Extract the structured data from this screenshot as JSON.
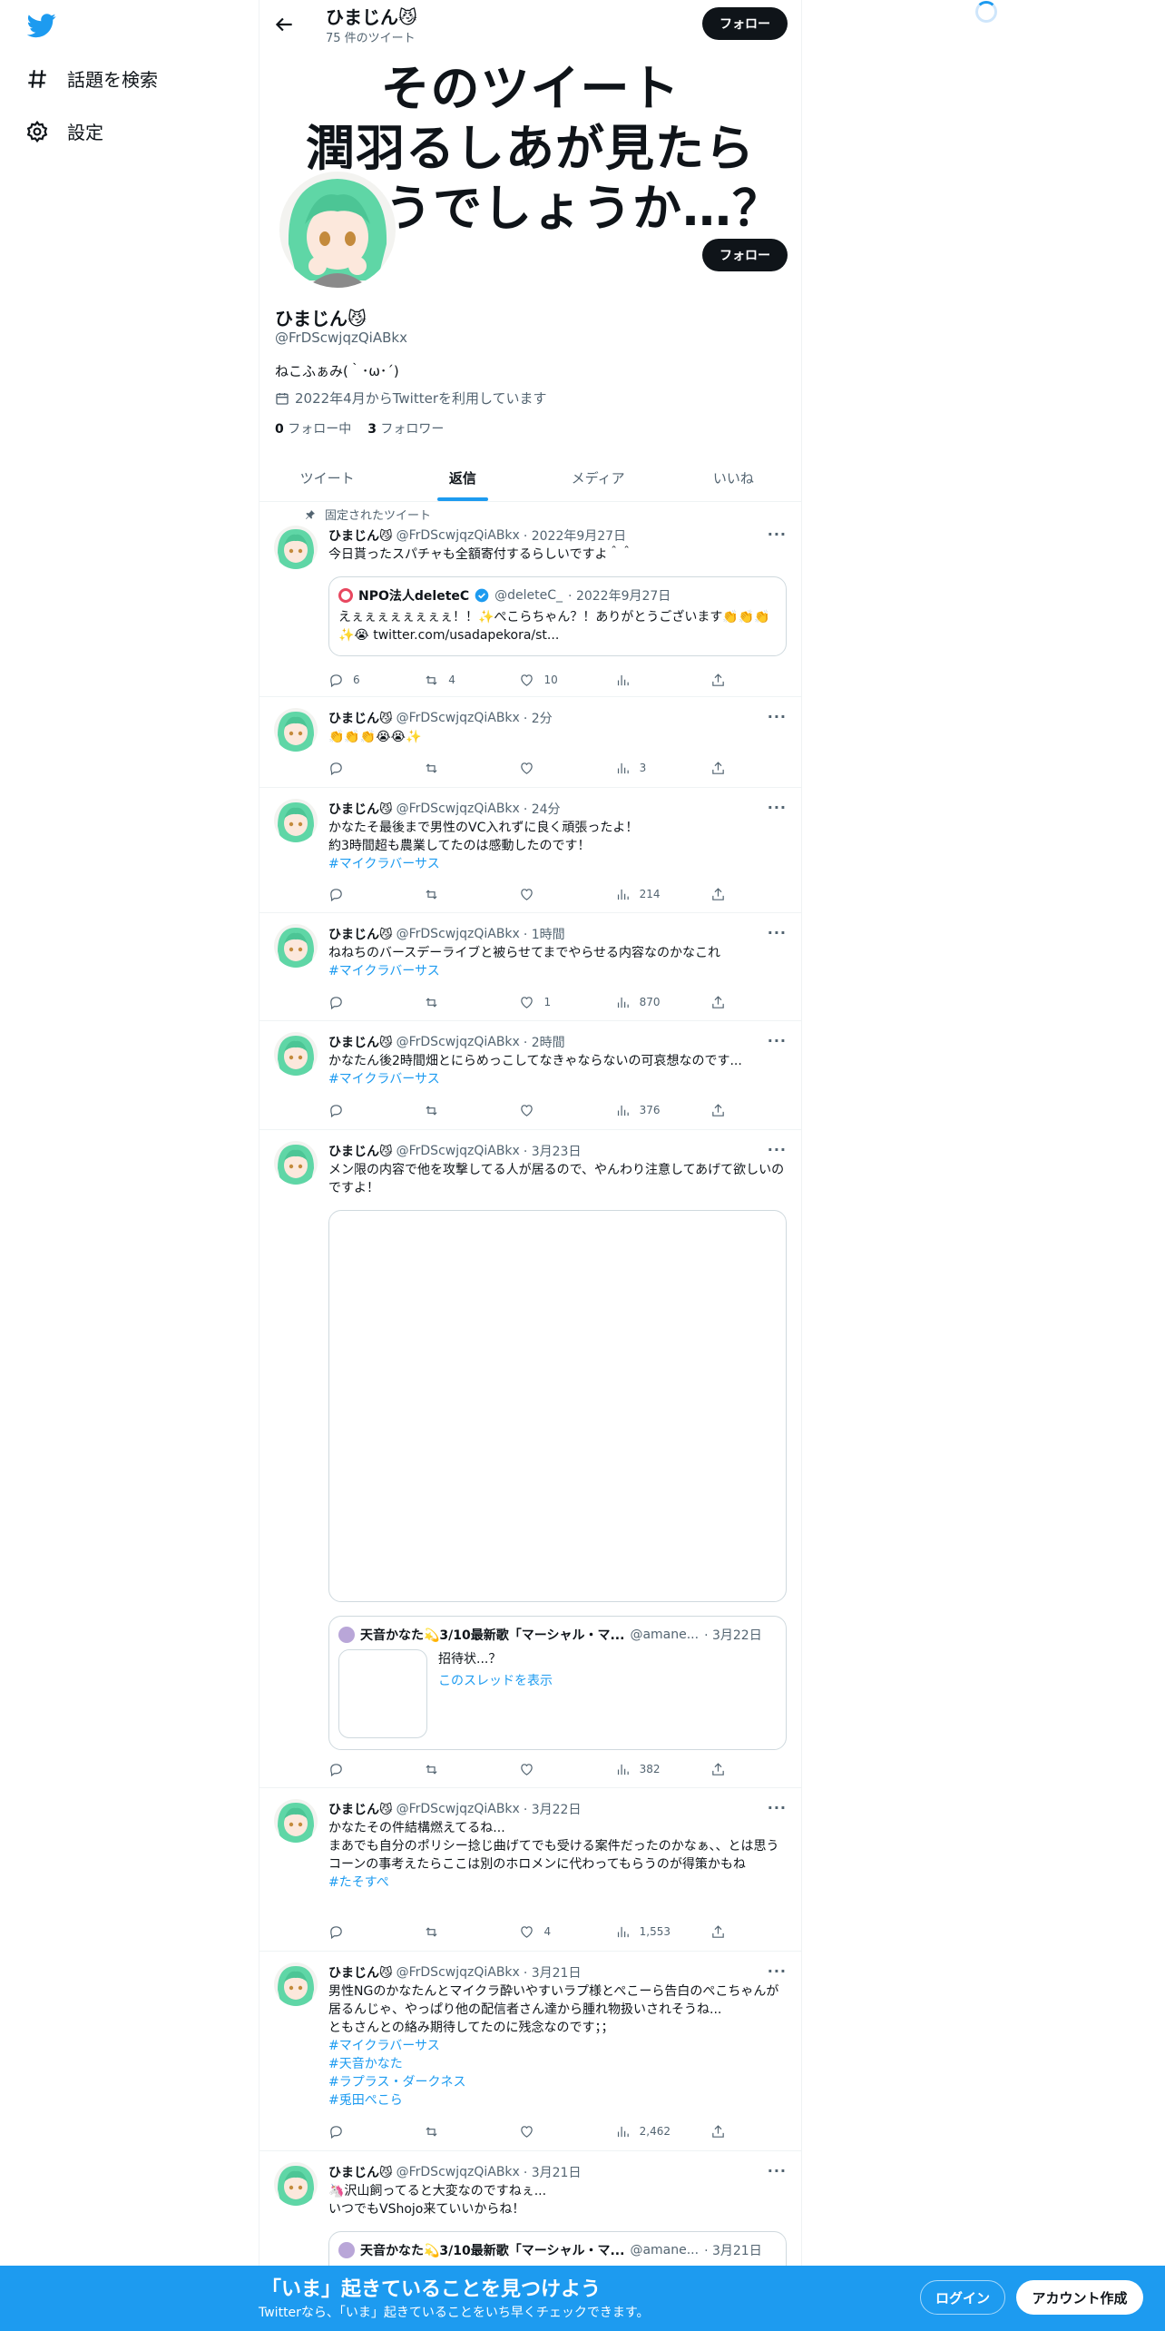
{
  "nav": {
    "explore": "話題を検索",
    "settings": "設定"
  },
  "header": {
    "name": "ひまじん😼",
    "count": "75 件のツイート",
    "follow": "フォロー"
  },
  "banner": {
    "line1": "そのツイート",
    "line2": "潤羽るしあが見たら",
    "line3": "思うでしょうか…？"
  },
  "profile": {
    "name": "ひまじん😼",
    "handle": "@FrDScwjqzQiABkx",
    "bio": "ねこふぁみ(｀･ω･´)",
    "joined": "2022年4月からTwitterを利用しています",
    "following_count": "0",
    "following_label": "フォロー中",
    "followers_count": "3",
    "followers_label": "フォロワー",
    "follow": "フォロー"
  },
  "tabs": [
    "ツイート",
    "返信",
    "メディア",
    "いいね"
  ],
  "pinned_label": "固定されたツイート",
  "tweets": [
    {
      "name": "ひまじん😼",
      "handle": "@FrDScwjqzQiABkx",
      "time": "· 2022年9月27日",
      "text": "今日貰ったスパチャも全額寄付するらしいですよ＾＾",
      "quote": {
        "name": "NPO法人deleteC",
        "handle": "@deleteC_",
        "time": "· 2022年9月27日",
        "text": "えぇぇぇぇぇぇぇぇ！！✨ぺこらちゃん？！ありがとうございます👏👏👏✨😭 twitter.com/usadapekora/st..."
      },
      "reply": "6",
      "retweet": "4",
      "like": "10",
      "views": ""
    },
    {
      "name": "ひまじん😼",
      "handle": "@FrDScwjqzQiABkx",
      "time": "· 2分",
      "text": "👏👏👏😭😭✨",
      "reply": "",
      "retweet": "",
      "like": "",
      "views": "3"
    },
    {
      "name": "ひまじん😼",
      "handle": "@FrDScwjqzQiABkx",
      "time": "· 24分",
      "text": "かなたそ最後まで男性のVC入れずに良く頑張ったよ！",
      "text2": "約3時間超も農業してたのは感動したのです！",
      "tag1": "#マイクラバーサス",
      "reply": "",
      "retweet": "",
      "like": "",
      "views": "214"
    },
    {
      "name": "ひまじん😼",
      "handle": "@FrDScwjqzQiABkx",
      "time": "· 1時間",
      "text": "ねねちのバースデーライブと被らせてまでやらせる内容なのかなこれ",
      "tag1": "#マイクラバーサス",
      "reply": "",
      "retweet": "",
      "like": "1",
      "views": "870"
    },
    {
      "name": "ひまじん😼",
      "handle": "@FrDScwjqzQiABkx",
      "time": "· 2時間",
      "text": "かなたん後2時間畑とにらめっこしてなきゃならないの可哀想なのです...",
      "tag1": "#マイクラバーサス",
      "reply": "",
      "retweet": "",
      "like": "",
      "views": "376"
    },
    {
      "name": "ひまじん😼",
      "handle": "@FrDScwjqzQiABkx",
      "time": "· 3月23日",
      "text": "メン限の内容で他を攻撃してる人が居るので、やんわり注意してあげて欲しいのですよ！",
      "quote": {
        "name": "天音かなた💫3/10最新歌「マーシャル・マ...",
        "handle": "@amane...",
        "time": "· 3月22日",
        "text": "招待状...？",
        "link": "このスレッドを表示"
      },
      "reply": "",
      "retweet": "",
      "like": "",
      "views": "382"
    },
    {
      "name": "ひまじん😼",
      "handle": "@FrDScwjqzQiABkx",
      "time": "· 3月22日",
      "text": "かなたその件結構燃えてるね...",
      "text2": "まあでも自分のポリシー捻じ曲げてでも受ける案件だったのかなぁ、、とは思う",
      "text3": "コーンの事考えたらここは別のホロメンに代わってもらうのが得策かもね",
      "tag1": "#たそすぺ",
      "reply": "",
      "retweet": "",
      "like": "4",
      "views": "1,553"
    },
    {
      "name": "ひまじん😼",
      "handle": "@FrDScwjqzQiABkx",
      "time": "· 3月21日",
      "text": "男性NGのかなたんとマイクラ酔いやすいラプ様とぺこーら告白のぺこちゃんが居るんじゃ、やっぱり他の配信者さん達から腫れ物扱いされそうね...",
      "text2": "ともさんとの絡み期待してたのに残念なのです；；",
      "tag1": "#マイクラバーサス",
      "tag2": "#天音かなた",
      "tag3": "#ラプラス・ダークネス",
      "tag4": "#兎田ぺこら",
      "reply": "",
      "retweet": "",
      "like": "",
      "views": "2,462"
    },
    {
      "name": "ひまじん😼",
      "handle": "@FrDScwjqzQiABkx",
      "time": "· 3月21日",
      "text": "🦄沢山飼ってると大変なのですねぇ...",
      "text2": "いつでもVShojo来ていいからね！",
      "quote": {
        "name": "天音かなた💫3/10最新歌「マーシャル・マ...",
        "handle": "@amane...",
        "time": "· 3月21日"
      }
    }
  ],
  "bottom": {
    "title": "「いま」起きていることを見つけよう",
    "subtitle": "Twitterなら、「いま」起きていることをいち早くチェックできます。",
    "login": "ログイン",
    "signup": "アカウント作成"
  },
  "colors": {
    "accent": "#1d9bf0",
    "text": "#0f1419",
    "muted": "#536471"
  }
}
